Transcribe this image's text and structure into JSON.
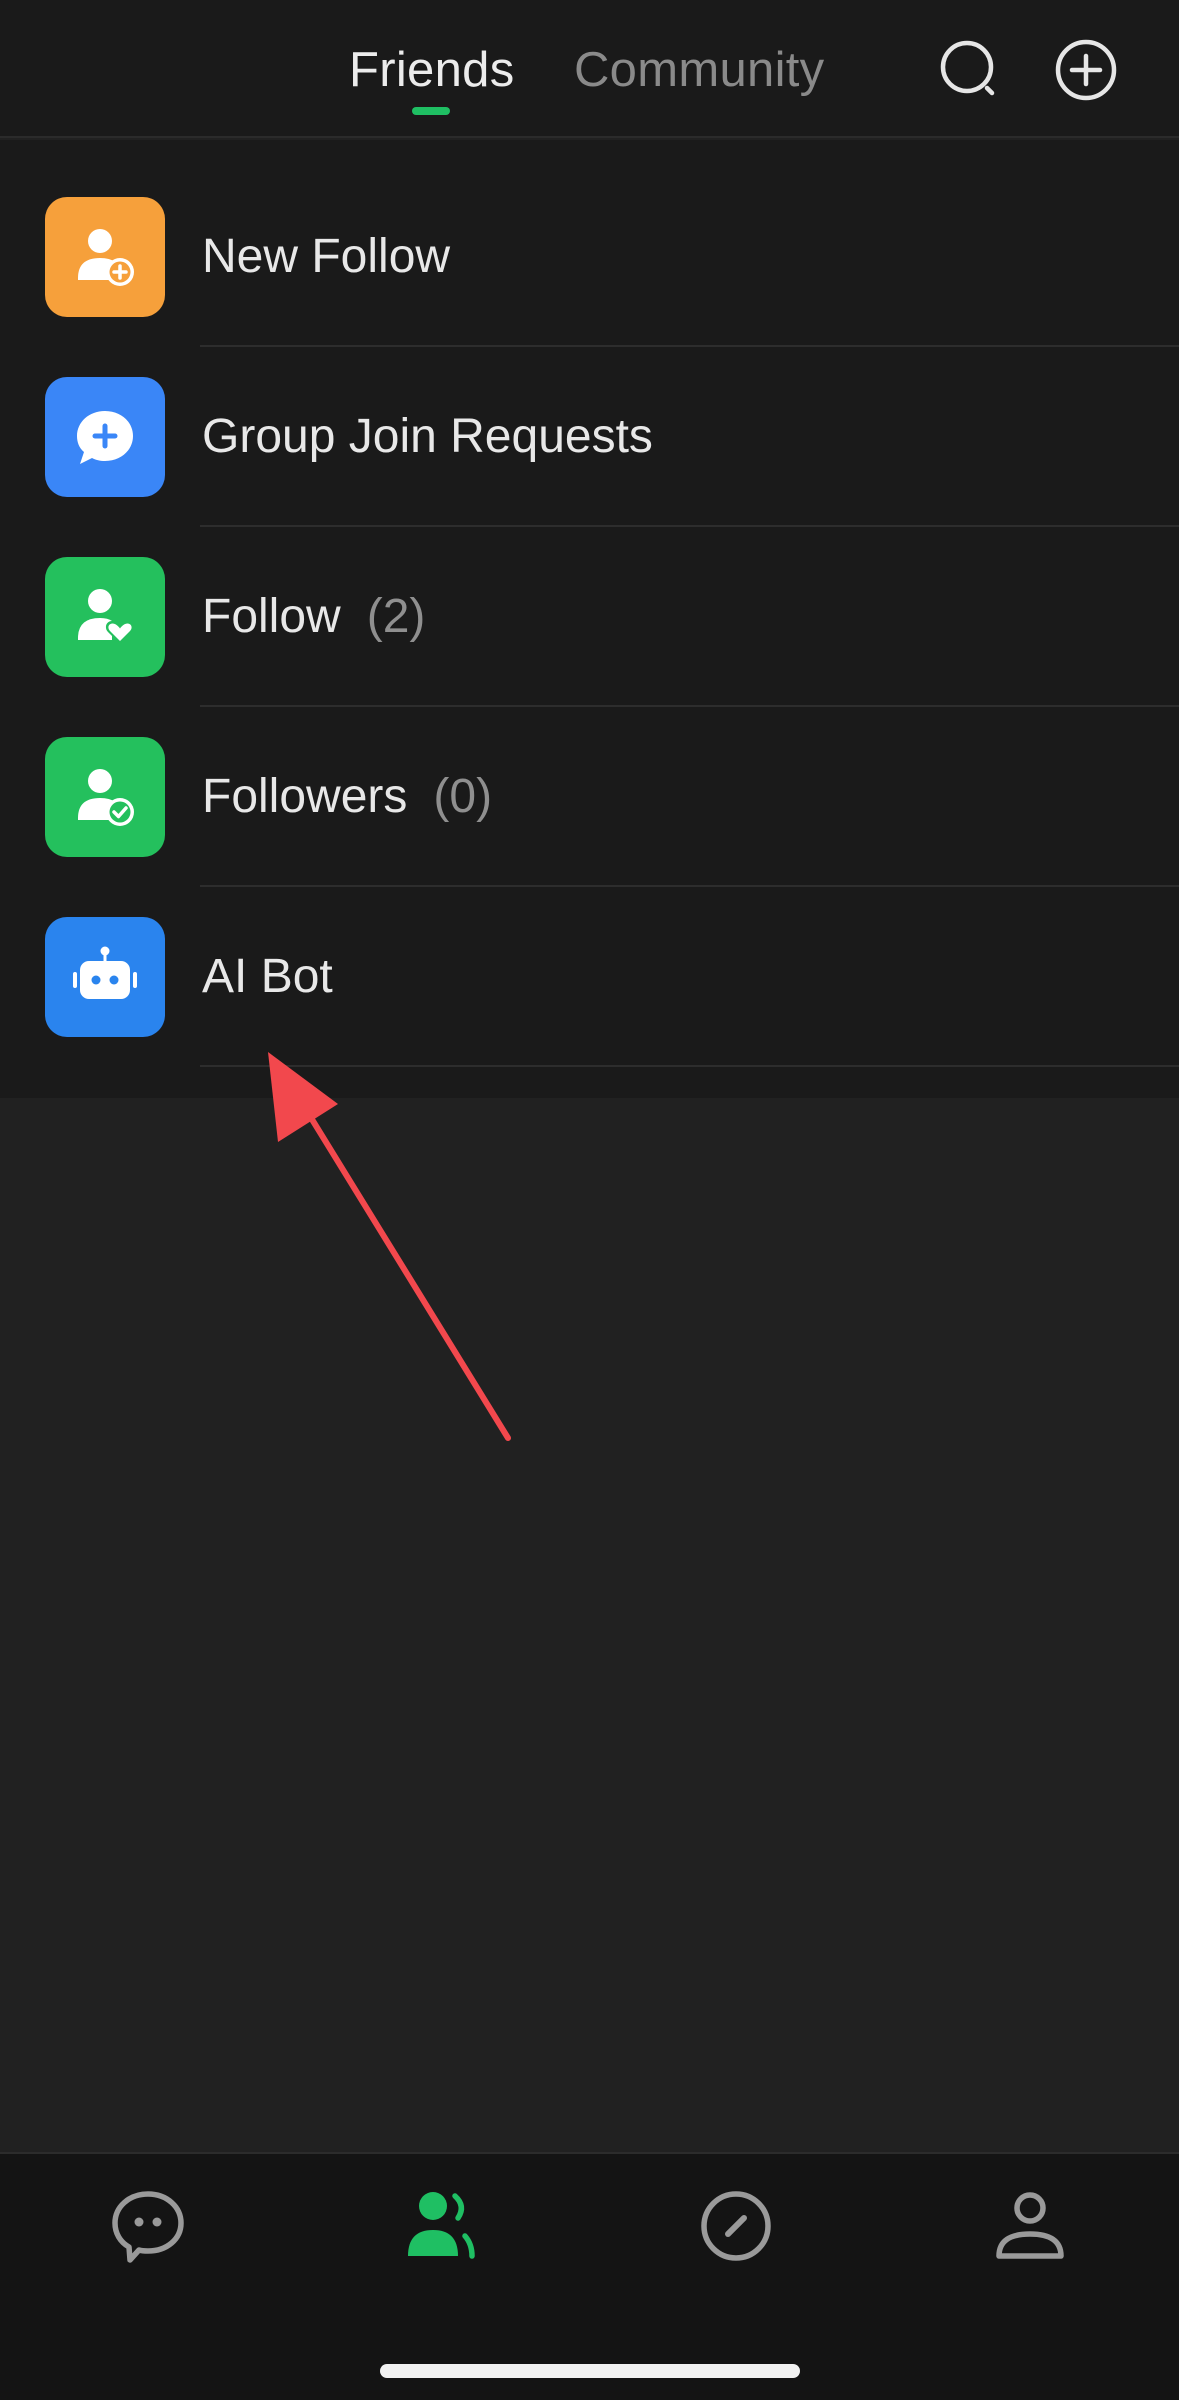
{
  "header": {
    "tabs": [
      {
        "label": "Friends",
        "active": true
      },
      {
        "label": "Community",
        "active": false
      }
    ],
    "icons": [
      "search-icon",
      "add-circle-icon"
    ]
  },
  "list": {
    "items": [
      {
        "label": "New Follow",
        "count": "",
        "icon": "person-add-icon",
        "color": "#f6a03b"
      },
      {
        "label": "Group Join Requests",
        "count": "",
        "icon": "chat-plus-icon",
        "color": "#3a86f7"
      },
      {
        "label": "Follow",
        "count": "(2)",
        "icon": "person-heart-icon",
        "color": "#24c05d"
      },
      {
        "label": "Followers",
        "count": "(0)",
        "icon": "person-check-icon",
        "color": "#24c05d"
      },
      {
        "label": "AI Bot",
        "count": "",
        "icon": "robot-icon",
        "color": "#2a84ee"
      }
    ]
  },
  "bottom_nav": {
    "items": [
      {
        "icon": "chat-bubble-icon",
        "active": false
      },
      {
        "icon": "contacts-icon",
        "active": true
      },
      {
        "icon": "compass-icon",
        "active": false
      },
      {
        "icon": "profile-icon",
        "active": false
      }
    ]
  },
  "colors": {
    "accent": "#1fbf63",
    "annotation_arrow": "#f2484d"
  }
}
